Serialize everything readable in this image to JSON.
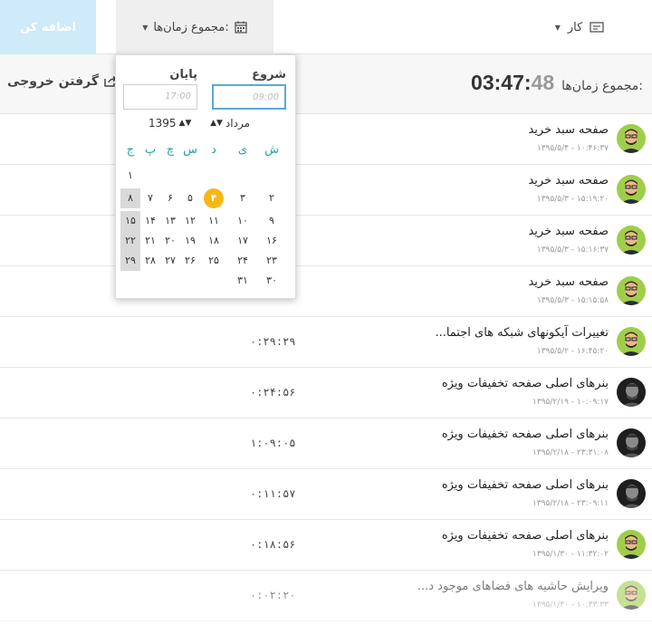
{
  "topbar": {
    "add_label": "اضافه کن",
    "total_dropdown_label": "مجموع زمان‌ها:",
    "work_dropdown_label": "کار"
  },
  "summary": {
    "label": "مجموع زمان‌ها:",
    "hours": "03",
    "minutes": "47",
    "seconds": "48",
    "export_label": "گرفتن خروجی"
  },
  "calendar": {
    "start_label": "شروع",
    "end_label": "پایان",
    "start_placeholder": "09:00",
    "end_placeholder": "17:00",
    "month": "مرداد",
    "year": "1395",
    "weekdays": [
      "ش",
      "ی",
      "د",
      "س",
      "چ",
      "پ",
      "ج"
    ],
    "today": "۴",
    "weeks": [
      [
        "",
        "",
        "",
        "",
        "",
        "",
        "۱"
      ],
      [
        "۲",
        "۳",
        "۴",
        "۵",
        "۶",
        "۷",
        "۸"
      ],
      [
        "۹",
        "۱۰",
        "۱۱",
        "۱۲",
        "۱۳",
        "۱۴",
        "۱۵"
      ],
      [
        "۱۶",
        "۱۷",
        "۱۸",
        "۱۹",
        "۲۰",
        "۲۱",
        "۲۲"
      ],
      [
        "۲۳",
        "۲۴",
        "۲۵",
        "۲۶",
        "۲۷",
        "۲۸",
        "۲۹"
      ],
      [
        "۳۰",
        "۳۱",
        "",
        "",
        "",
        "",
        ""
      ]
    ]
  },
  "tasks": [
    {
      "title": "صفحه سبد خرید",
      "date": "۱۳۹۵/۵/۴ - ۱۰:۴۶:۳۷",
      "duration": "",
      "avatar": "green"
    },
    {
      "title": "صفحه سبد خرید",
      "date": "۱۳۹۵/۵/۳ - ۱۵:۱۹:۲۰",
      "duration": "",
      "avatar": "green"
    },
    {
      "title": "صفحه سبد خرید",
      "date": "۱۳۹۵/۵/۳ - ۱۵:۱۶:۳۷",
      "duration": "",
      "avatar": "green"
    },
    {
      "title": "صفحه سبد خرید",
      "date": "۱۳۹۵/۵/۳ - ۱۵:۱۵:۵۸",
      "duration": "",
      "avatar": "green"
    },
    {
      "title": "تغییرات آیکونهای شبکه های اجتما...",
      "date": "۱۳۹۵/۵/۲ - ۱۶:۴۵:۲۰",
      "duration": "۰:۲۹:۲۹",
      "avatar": "green"
    },
    {
      "title": "بنرهای اصلی صفحه تخفیفات ویژه",
      "date": "۱۳۹۵/۲/۱۹ - ۱۰:۰۹:۱۷",
      "duration": "۰:۲۴:۵۶",
      "avatar": "dark"
    },
    {
      "title": "بنرهای اصلی صفحه تخفیفات ویژه",
      "date": "۱۳۹۵/۲/۱۸ - ۲۳:۳۱:۰۸",
      "duration": "۱:۰۹:۰۵",
      "avatar": "dark"
    },
    {
      "title": "بنرهای اصلی صفحه تخفیفات ویژه",
      "date": "۱۳۹۵/۲/۱۸ - ۲۳:۰۹:۱۱",
      "duration": "۰:۱۱:۵۷",
      "avatar": "dark"
    },
    {
      "title": "بنرهای اصلی صفحه تخفیفات ویژه",
      "date": "۱۳۹۵/۱/۳۰ - ۱۱:۳۲:۰۲",
      "duration": "۰:۱۸:۵۶",
      "avatar": "green"
    },
    {
      "title": "ویرایش حاشیه های فضاهای موجود د...",
      "date": "۱۳۹۵/۱/۳۰ - ۱۰:۳۳:۳۳",
      "duration": "۰:۰۲:۲۰",
      "avatar": "green"
    }
  ]
}
